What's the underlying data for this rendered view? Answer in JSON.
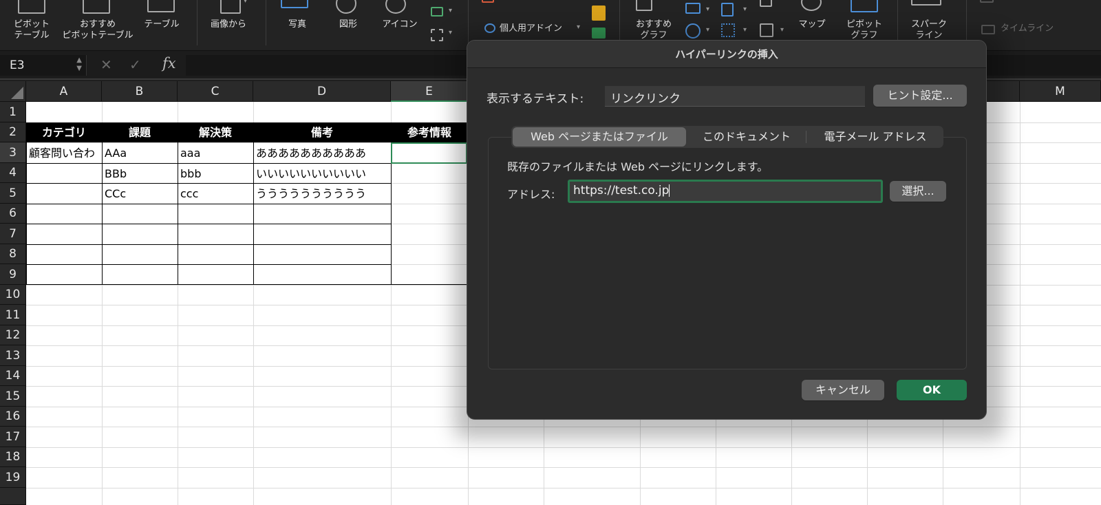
{
  "ribbon": {
    "pivot_table": "ピボット\nテーブル",
    "recommended_pivot": "おすすめ\nピボットテーブル",
    "table": "テーブル",
    "from_picture": "画像から",
    "photo": "写真",
    "shapes": "図形",
    "icons": "アイコン",
    "personal_addins": "個人用アドイン",
    "recommended_charts": "おすすめ\nグラフ",
    "map": "マップ",
    "pivot_chart": "ピボット\nグラフ",
    "sparklines": "スパーク\nライン",
    "timeline": "タイムライン"
  },
  "formula_bar": {
    "name_box": "E3",
    "fx": "fx",
    "value": ""
  },
  "sheet": {
    "columns": [
      "A",
      "B",
      "C",
      "D",
      "E",
      "M"
    ],
    "rows": [
      "1",
      "2",
      "3",
      "4",
      "5",
      "6",
      "7",
      "8",
      "9",
      "10",
      "11",
      "12",
      "13",
      "14",
      "15",
      "16",
      "17",
      "18",
      "19"
    ],
    "header": [
      "カテゴリ",
      "課題",
      "解決策",
      "備考",
      "参考情報"
    ],
    "data": [
      [
        "顧客問い合わ",
        "AAa",
        "aaa",
        "ああああああああああ"
      ],
      [
        "",
        "BBb",
        "bbb",
        "いいいいいいいいいい"
      ],
      [
        "",
        "CCc",
        "ccc",
        "うううううううううう"
      ]
    ]
  },
  "dialog": {
    "title": "ハイパーリンクの挿入",
    "display_text_label": "表示するテキスト:",
    "display_text_value": "リンクリンク",
    "hint_button": "ヒント設定...",
    "tabs": [
      "Web ページまたはファイル",
      "このドキュメント",
      "電子メール アドレス"
    ],
    "description": "既存のファイルまたは Web ページにリンクします。",
    "address_label": "アドレス:",
    "address_value": "https://test.co.jp",
    "select_button": "選択...",
    "cancel_button": "キャンセル",
    "ok_button": "OK"
  },
  "colors": {
    "accent": "#227a4e",
    "focus": "#2a7a4e"
  }
}
